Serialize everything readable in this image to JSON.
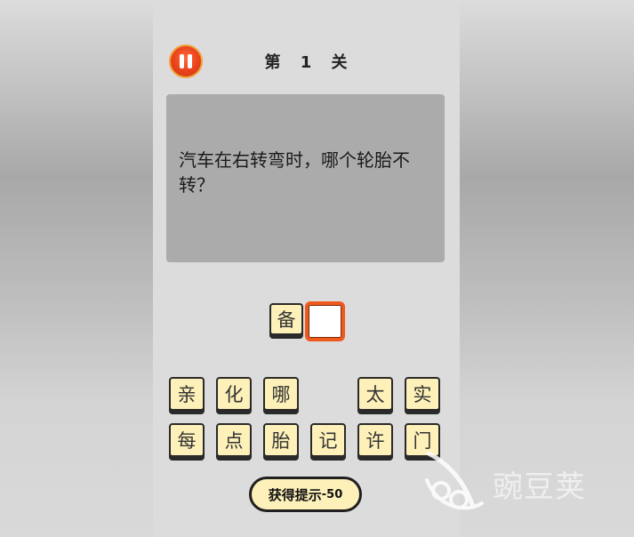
{
  "level": {
    "title": "第 1 关"
  },
  "question": {
    "text": "汽车在右转弯时，哪个轮胎不转？"
  },
  "answer": {
    "slots": [
      "备",
      ""
    ]
  },
  "choices": {
    "row1": [
      "亲",
      "化",
      "哪",
      "",
      "太",
      "实"
    ],
    "row2": [
      "每",
      "点",
      "胎",
      "记",
      "许",
      "门"
    ]
  },
  "hint": {
    "label": "获得提示",
    "cost": "-50"
  },
  "watermark": {
    "text": "豌豆荚"
  },
  "colors": {
    "tile_bg": "#fdf0b9",
    "accent": "#ee5a1e",
    "question_bg": "#ababab"
  },
  "icons": {
    "pause": "pause-icon",
    "watermark_logo": "pea-pod-logo"
  }
}
